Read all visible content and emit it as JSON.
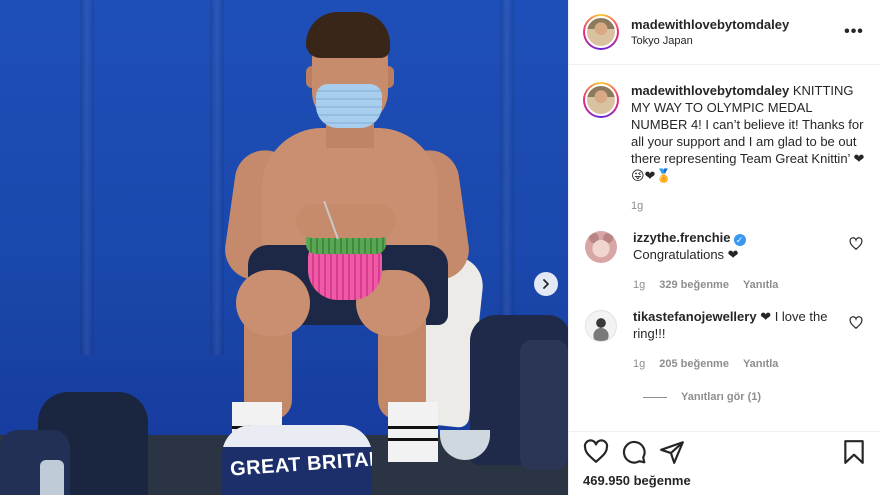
{
  "post": {
    "username": "madewithlovebytomdaley",
    "location": "Tokyo Japan",
    "photo_text": "GREAT BRITAIN",
    "caption": {
      "username": "madewithlovebytomdaley",
      "text": "KNITTING MY WAY TO OLYMPIC MEDAL NUMBER 4! I can’t believe it! Thanks for all your support and I am glad to be out there representing Team Great Knittin’ ❤😜❤🏅",
      "time": "1g"
    },
    "comments": [
      {
        "username": "izzythe.frenchie",
        "verified": true,
        "text": "Congratulations ❤",
        "time": "1g",
        "likes": "329 beğenme",
        "reply_label": "Yanıtla"
      },
      {
        "username": "tikastefanojewellery",
        "verified": false,
        "text": "❤ I love the ring!!!",
        "time": "1g",
        "likes": "205 beğenme",
        "reply_label": "Yanıtla",
        "view_replies": "Yanıtları gör (1)"
      }
    ],
    "likes_count": "469.950 beğenme"
  },
  "colors": {
    "accent_blue": "#3897f0",
    "heart_red": "#ed4956",
    "muted_text": "#8e8e8e"
  },
  "icons": [
    "more-options-icon",
    "next-arrow-icon",
    "heart-icon",
    "comment-icon",
    "share-icon",
    "bookmark-icon",
    "verified-badge-icon"
  ]
}
